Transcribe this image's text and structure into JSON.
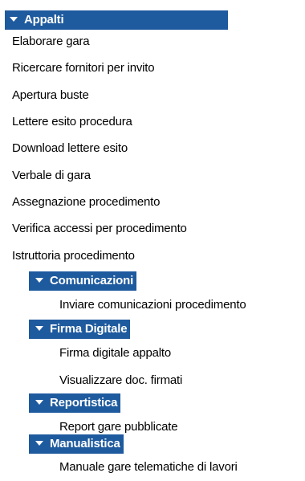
{
  "appalti": {
    "label": "Appalti",
    "items": [
      "Elaborare gara",
      "Ricercare fornitori per invito",
      "Apertura buste",
      "Lettere esito procedura",
      "Download lettere esito",
      "Verbale di gara",
      "Assegnazione procedimento",
      "Verifica accessi per procedimento",
      "Istruttoria procedimento"
    ]
  },
  "comunicazioni": {
    "label": "Comunicazioni",
    "items": [
      "Inviare comunicazioni procedimento"
    ]
  },
  "firma_digitale": {
    "label": "Firma Digitale",
    "items": [
      "Firma digitale appalto",
      "Visualizzare doc. firmati"
    ]
  },
  "reportistica": {
    "label": "Reportistica",
    "items": [
      "Report gare pubblicate"
    ]
  },
  "manualistica": {
    "label": "Manualistica",
    "items": [
      "Manuale gare telematiche di lavori"
    ]
  }
}
